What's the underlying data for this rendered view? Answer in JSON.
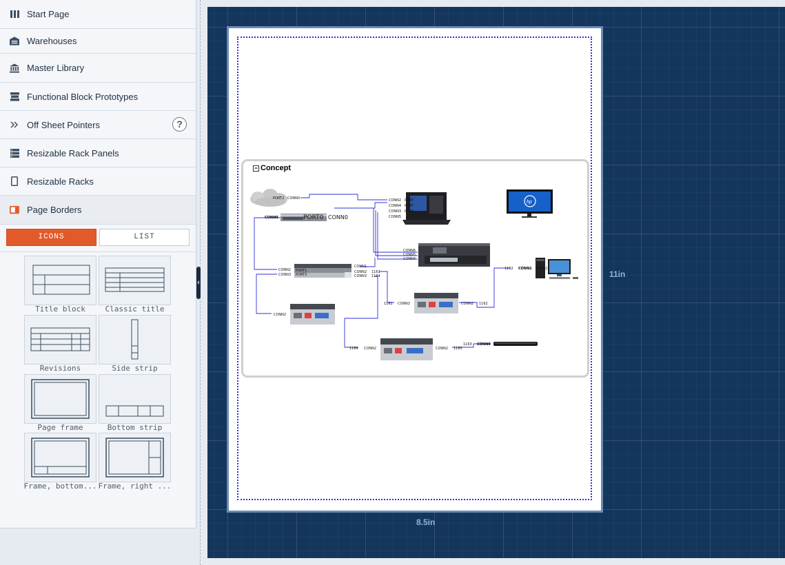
{
  "sidebar": {
    "items": [
      {
        "label": "Start Page",
        "icon": "columns-icon"
      },
      {
        "label": "Warehouses",
        "icon": "warehouse-icon"
      },
      {
        "label": "Master Library",
        "icon": "library-icon"
      },
      {
        "label": "Functional Block Prototypes",
        "icon": "stack-icon"
      },
      {
        "label": "Off Sheet Pointers",
        "icon": "double-chevron-right-icon",
        "help": "?"
      },
      {
        "label": "Resizable Rack Panels",
        "icon": "rack-panel-icon"
      },
      {
        "label": "Resizable Racks",
        "icon": "rack-outline-icon"
      },
      {
        "label": "Page Borders",
        "icon": "page-border-icon",
        "active": true
      }
    ],
    "view_toggle": {
      "icons": "ICONS",
      "list": "LIST",
      "selected": "ICONS"
    },
    "tiles": [
      {
        "label": "Title block"
      },
      {
        "label": "Classic title"
      },
      {
        "label": "Revisions"
      },
      {
        "label": "Side strip"
      },
      {
        "label": "Page frame"
      },
      {
        "label": "Bottom strip"
      },
      {
        "label": "Frame, bottom..."
      },
      {
        "label": "Frame, right ..."
      }
    ]
  },
  "colors": {
    "accent": "#e25a2a",
    "canvas": "#14365c",
    "connector": "#2f2fd6"
  },
  "canvas": {
    "height_label": "11in",
    "width_label": "8.5in",
    "group_title": "Concept",
    "collapse_symbol": "−",
    "port_labels": {
      "port2": "PORT2",
      "port0": "PORT0",
      "port1": "PORT1",
      "port3": "PORT3",
      "port": "PORT",
      "conn0": "CONN0",
      "conn1": "CONN1",
      "conn2": "CONN2",
      "conn3": "CONN3",
      "conn4": "CONN4",
      "conn5": "CONN5",
      "conn6": "CONN6",
      "id1161": "1161",
      "id1162": "1162",
      "id1163": "1163",
      "id1164": "1164",
      "hp_logo": "hp"
    }
  }
}
